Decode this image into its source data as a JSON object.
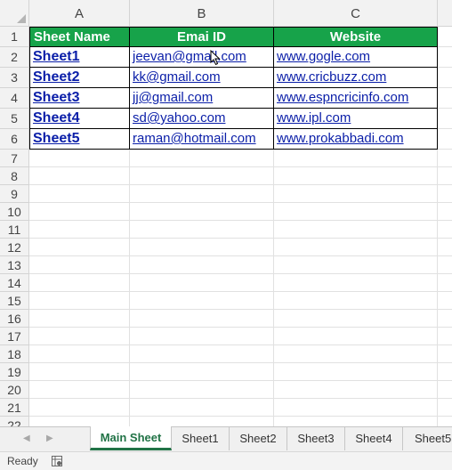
{
  "columns": [
    "A",
    "B",
    "C"
  ],
  "rows": [
    "1",
    "2",
    "3",
    "4",
    "5",
    "6",
    "7",
    "8",
    "9",
    "10",
    "11",
    "12",
    "13",
    "14",
    "15",
    "16",
    "17",
    "18",
    "19",
    "20",
    "21",
    "22"
  ],
  "table": {
    "headers": [
      "Sheet Name",
      "Emai ID",
      "Website"
    ],
    "records": [
      [
        "Sheet1",
        "jeevan@gmail.com",
        "www.gogle.com"
      ],
      [
        "Sheet2",
        "kk@gmail.com",
        "www.cricbuzz.com"
      ],
      [
        "Sheet3",
        "jj@gmail.com",
        "www.espncricinfo.com"
      ],
      [
        "Sheet4",
        "sd@yahoo.com",
        "www.ipl.com"
      ],
      [
        "Sheet5",
        "raman@hotmail.com",
        "www.prokabbadi.com"
      ]
    ]
  },
  "colors": {
    "header_fill": "#17a34a",
    "header_text": "#ffffff",
    "link": "#0a1ea8",
    "active_tab": "#217346"
  },
  "tabs": [
    "Main Sheet",
    "Sheet1",
    "Sheet2",
    "Sheet3",
    "Sheet4",
    "Sheet5"
  ],
  "active_tab": "Main Sheet",
  "status": {
    "text": "Ready",
    "icon": "macro-record-icon"
  },
  "icons": {
    "nav_prev": "triangle-left-icon",
    "nav_next": "triangle-right-icon",
    "cursor": "mouse-pointer-icon"
  }
}
